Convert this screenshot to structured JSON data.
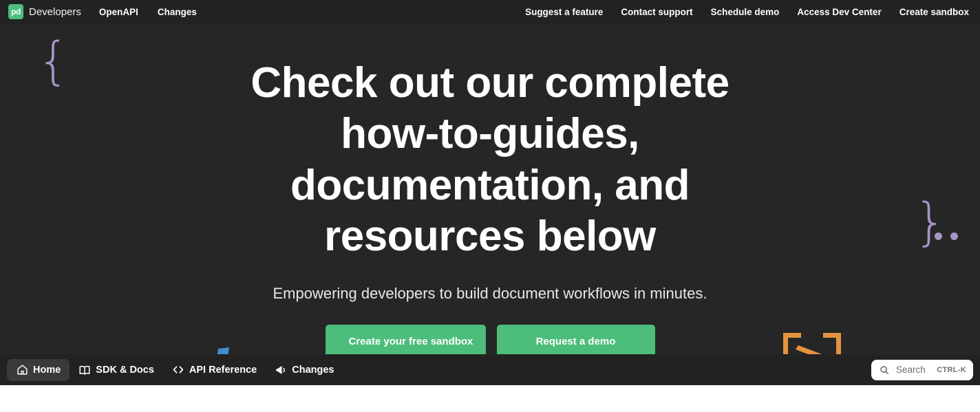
{
  "topnav": {
    "brand": {
      "logo_text": "pd",
      "logo_color": "#4bbd7f",
      "name": "Developers"
    },
    "left_links": [
      {
        "label": "OpenAPI"
      },
      {
        "label": "Changes"
      }
    ],
    "right_links": [
      {
        "label": "Suggest a feature"
      },
      {
        "label": "Contact support"
      },
      {
        "label": "Schedule demo"
      },
      {
        "label": "Access Dev Center"
      },
      {
        "label": "Create sandbox"
      }
    ]
  },
  "hero": {
    "title": "Check out our complete how-to-guides, documentation, and resources below",
    "subtitle": "Empowering developers to build document workflows in minutes.",
    "buttons": {
      "primary": "Create your free sandbox",
      "secondary": "Request a demo"
    },
    "background_color": "#262626",
    "button_color": "#4cbd7b"
  },
  "decorations": {
    "brace_open": "{",
    "brace_close": "}",
    "brace_color": "#a894c7",
    "orange_color": "#e5933f",
    "blue_color": "#3f8fd0"
  },
  "dock": {
    "items": [
      {
        "label": "Home",
        "icon": "home-icon",
        "active": true
      },
      {
        "label": "SDK & Docs",
        "icon": "book-icon",
        "active": false
      },
      {
        "label": "API Reference",
        "icon": "code-brackets-icon",
        "active": false
      },
      {
        "label": "Changes",
        "icon": "megaphone-icon",
        "active": false
      }
    ],
    "search": {
      "placeholder": "Search",
      "shortcut": "CTRL-K"
    }
  }
}
